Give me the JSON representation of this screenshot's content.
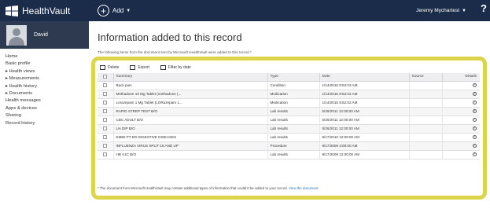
{
  "app": {
    "brand": "HealthVault",
    "add_label": "Add",
    "user_name": "Jeremy Mychartest",
    "help_label": "?"
  },
  "sidebar": {
    "profile_name": "David",
    "items": [
      {
        "label": "Home"
      },
      {
        "label": "Basic profile"
      },
      {
        "label": "▸ Health views"
      },
      {
        "label": "▸ Measurements"
      },
      {
        "label": "▸ Health history"
      },
      {
        "label": "▸ Documents"
      },
      {
        "label": "Health messages"
      },
      {
        "label": "Apps & devices"
      },
      {
        "label": "Sharing"
      },
      {
        "label": "Record history"
      }
    ]
  },
  "main": {
    "title": "Information added to this record",
    "intro": "The following items from the document sent by Microsoft HealthVault were added to this record.*",
    "toolbar": {
      "delete_label": "Delete",
      "export_label": "Export",
      "filter_label": "Filter by date"
    },
    "table": {
      "headers": {
        "summary": "Summary",
        "type": "Type",
        "date": "Date",
        "source": "Source",
        "details": "Details"
      },
      "rows": [
        {
          "summary": "Back pain",
          "type": "Condition",
          "date": "1/14/2015 9:52:03 AM",
          "source": ""
        },
        {
          "summary": "Methadone 10 Mg Tablet (methadone (...",
          "type": "Medication",
          "date": "1/14/2015 9:52:02 AM",
          "source": ""
        },
        {
          "summary": "Lorazepam 1 Mg Tablet (LORazepam 1...",
          "type": "Medication",
          "date": "1/14/2015 9:52:02 AM",
          "source": ""
        },
        {
          "summary": "RAPID STREP TEST B/O",
          "type": "Lab results",
          "date": "5/26/2011 12:00:00 AM",
          "source": ""
        },
        {
          "summary": "CBC ADULT B/O",
          "type": "Lab results",
          "date": "5/26/2011 12:00:00 AM",
          "source": ""
        },
        {
          "summary": "UA DIP B/O",
          "type": "Lab results",
          "date": "5/26/2011 12:00:00 AM",
          "source": ""
        },
        {
          "summary": "EMMI PT ED DIGESTIVE DISEASES",
          "type": "Lab results",
          "date": "9/17/2010 12:00:00 AM",
          "source": ""
        },
        {
          "summary": "INFLUENZA VIRUS SPLIT-18 AND UP",
          "type": "Procedure",
          "date": "9/17/2009 4:00:00 AM",
          "source": ""
        },
        {
          "summary": "HB A1C B/O",
          "type": "Lab results",
          "date": "9/17/2009 12:00:00 AM",
          "source": ""
        }
      ]
    },
    "footnote": "* The document from Microsoft HealthVault may contain additional types of information that couldn't be added to your record.",
    "footnote_link": "View the document."
  },
  "colors": {
    "topbar": "#1b2c4a",
    "profile": "#2e3a4f",
    "highlight": "#dcd54a",
    "link": "#1e6fb8"
  },
  "icons": [
    "windows-icon",
    "add-icon",
    "chevron-down-icon",
    "help-icon",
    "avatar-icon",
    "delete-icon",
    "export-icon",
    "calendar-icon",
    "details-icon"
  ]
}
